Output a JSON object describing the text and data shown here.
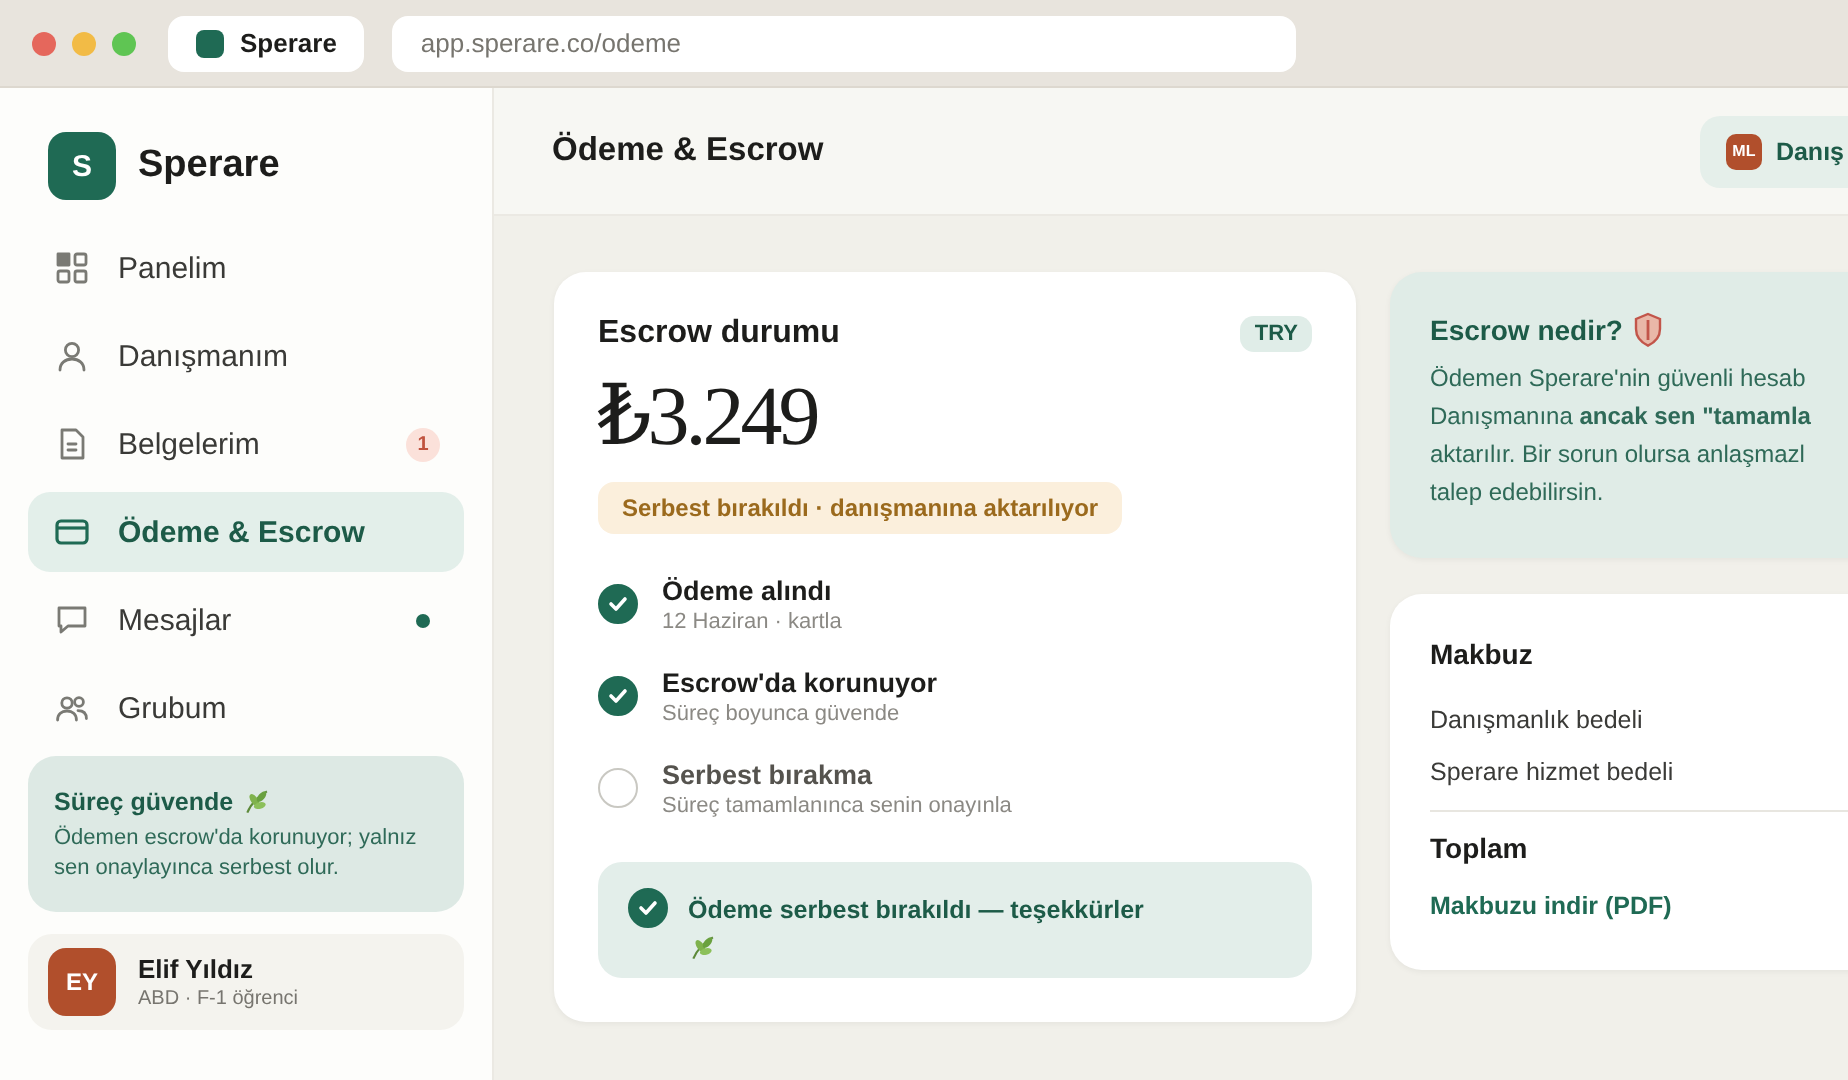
{
  "browser": {
    "tab_title": "Sperare",
    "url": "app.sperare.co/odeme"
  },
  "sidebar": {
    "brand": "Sperare",
    "logo_letter": "S",
    "items": [
      {
        "label": "Panelim",
        "selected": false
      },
      {
        "label": "Danışmanım",
        "selected": false
      },
      {
        "label": "Belgelerim",
        "selected": false,
        "badge": "1"
      },
      {
        "label": "Ödeme & Escrow",
        "selected": true
      },
      {
        "label": "Mesajlar",
        "selected": false,
        "unread": true
      },
      {
        "label": "Grubum",
        "selected": false
      }
    ],
    "promo": {
      "title": "Süreç güvende",
      "text": "Ödemen escrow'da korunuyor; yalnız sen onaylayınca serbest olur."
    },
    "user": {
      "initials": "EY",
      "name": "Elif Yıldız",
      "subtitle": "ABD · F-1 öğrenci"
    }
  },
  "header": {
    "title": "Ödeme & Escrow",
    "advisor_initials": "ML",
    "advisor_label": "Danış"
  },
  "escrow": {
    "title": "Escrow durumu",
    "currency": "TRY",
    "amount": "₺3.249",
    "status": "Serbest bırakıldı · danışmanına aktarılıyor",
    "steps": [
      {
        "title": "Ödeme alındı",
        "subtitle": "12 Haziran · kartla",
        "done": true
      },
      {
        "title": "Escrow'da korunuyor",
        "subtitle": "Süreç boyunca güvende",
        "done": true
      },
      {
        "title": "Serbest bırakma",
        "subtitle": "Süreç tamamlanınca senin onayınla",
        "done": false
      }
    ],
    "confirmation": "Ödeme serbest bırakıldı — teşekkürler"
  },
  "info": {
    "title": "Escrow nedir?",
    "lines": [
      "Ödemen Sperare'nin güvenli hesab",
      "Danışmanına **ancak sen \"tamamla**",
      "aktarılır. Bir sorun olursa anlaşmazl",
      "talep edebilirsin."
    ]
  },
  "receipt": {
    "title": "Makbuz",
    "rows": [
      "Danışmanlık bedeli",
      "Sperare hizmet bedeli"
    ],
    "total": "Toplam",
    "download": "Makbuzu indir (PDF)"
  }
}
